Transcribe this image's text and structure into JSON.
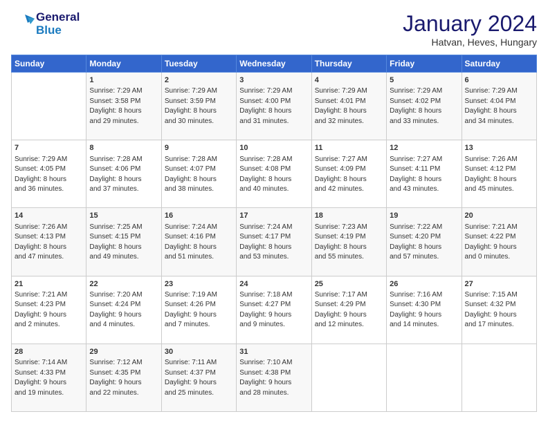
{
  "header": {
    "logo_line1": "General",
    "logo_line2": "Blue",
    "month_title": "January 2024",
    "subtitle": "Hatvan, Heves, Hungary"
  },
  "days": [
    "Sunday",
    "Monday",
    "Tuesday",
    "Wednesday",
    "Thursday",
    "Friday",
    "Saturday"
  ],
  "weeks": [
    [
      {
        "date": "",
        "content": ""
      },
      {
        "date": "1",
        "content": "Sunrise: 7:29 AM\nSunset: 3:58 PM\nDaylight: 8 hours\nand 29 minutes."
      },
      {
        "date": "2",
        "content": "Sunrise: 7:29 AM\nSunset: 3:59 PM\nDaylight: 8 hours\nand 30 minutes."
      },
      {
        "date": "3",
        "content": "Sunrise: 7:29 AM\nSunset: 4:00 PM\nDaylight: 8 hours\nand 31 minutes."
      },
      {
        "date": "4",
        "content": "Sunrise: 7:29 AM\nSunset: 4:01 PM\nDaylight: 8 hours\nand 32 minutes."
      },
      {
        "date": "5",
        "content": "Sunrise: 7:29 AM\nSunset: 4:02 PM\nDaylight: 8 hours\nand 33 minutes."
      },
      {
        "date": "6",
        "content": "Sunrise: 7:29 AM\nSunset: 4:04 PM\nDaylight: 8 hours\nand 34 minutes."
      }
    ],
    [
      {
        "date": "7",
        "content": "Sunrise: 7:29 AM\nSunset: 4:05 PM\nDaylight: 8 hours\nand 36 minutes."
      },
      {
        "date": "8",
        "content": "Sunrise: 7:28 AM\nSunset: 4:06 PM\nDaylight: 8 hours\nand 37 minutes."
      },
      {
        "date": "9",
        "content": "Sunrise: 7:28 AM\nSunset: 4:07 PM\nDaylight: 8 hours\nand 38 minutes."
      },
      {
        "date": "10",
        "content": "Sunrise: 7:28 AM\nSunset: 4:08 PM\nDaylight: 8 hours\nand 40 minutes."
      },
      {
        "date": "11",
        "content": "Sunrise: 7:27 AM\nSunset: 4:09 PM\nDaylight: 8 hours\nand 42 minutes."
      },
      {
        "date": "12",
        "content": "Sunrise: 7:27 AM\nSunset: 4:11 PM\nDaylight: 8 hours\nand 43 minutes."
      },
      {
        "date": "13",
        "content": "Sunrise: 7:26 AM\nSunset: 4:12 PM\nDaylight: 8 hours\nand 45 minutes."
      }
    ],
    [
      {
        "date": "14",
        "content": "Sunrise: 7:26 AM\nSunset: 4:13 PM\nDaylight: 8 hours\nand 47 minutes."
      },
      {
        "date": "15",
        "content": "Sunrise: 7:25 AM\nSunset: 4:15 PM\nDaylight: 8 hours\nand 49 minutes."
      },
      {
        "date": "16",
        "content": "Sunrise: 7:24 AM\nSunset: 4:16 PM\nDaylight: 8 hours\nand 51 minutes."
      },
      {
        "date": "17",
        "content": "Sunrise: 7:24 AM\nSunset: 4:17 PM\nDaylight: 8 hours\nand 53 minutes."
      },
      {
        "date": "18",
        "content": "Sunrise: 7:23 AM\nSunset: 4:19 PM\nDaylight: 8 hours\nand 55 minutes."
      },
      {
        "date": "19",
        "content": "Sunrise: 7:22 AM\nSunset: 4:20 PM\nDaylight: 8 hours\nand 57 minutes."
      },
      {
        "date": "20",
        "content": "Sunrise: 7:21 AM\nSunset: 4:22 PM\nDaylight: 9 hours\nand 0 minutes."
      }
    ],
    [
      {
        "date": "21",
        "content": "Sunrise: 7:21 AM\nSunset: 4:23 PM\nDaylight: 9 hours\nand 2 minutes."
      },
      {
        "date": "22",
        "content": "Sunrise: 7:20 AM\nSunset: 4:24 PM\nDaylight: 9 hours\nand 4 minutes."
      },
      {
        "date": "23",
        "content": "Sunrise: 7:19 AM\nSunset: 4:26 PM\nDaylight: 9 hours\nand 7 minutes."
      },
      {
        "date": "24",
        "content": "Sunrise: 7:18 AM\nSunset: 4:27 PM\nDaylight: 9 hours\nand 9 minutes."
      },
      {
        "date": "25",
        "content": "Sunrise: 7:17 AM\nSunset: 4:29 PM\nDaylight: 9 hours\nand 12 minutes."
      },
      {
        "date": "26",
        "content": "Sunrise: 7:16 AM\nSunset: 4:30 PM\nDaylight: 9 hours\nand 14 minutes."
      },
      {
        "date": "27",
        "content": "Sunrise: 7:15 AM\nSunset: 4:32 PM\nDaylight: 9 hours\nand 17 minutes."
      }
    ],
    [
      {
        "date": "28",
        "content": "Sunrise: 7:14 AM\nSunset: 4:33 PM\nDaylight: 9 hours\nand 19 minutes."
      },
      {
        "date": "29",
        "content": "Sunrise: 7:12 AM\nSunset: 4:35 PM\nDaylight: 9 hours\nand 22 minutes."
      },
      {
        "date": "30",
        "content": "Sunrise: 7:11 AM\nSunset: 4:37 PM\nDaylight: 9 hours\nand 25 minutes."
      },
      {
        "date": "31",
        "content": "Sunrise: 7:10 AM\nSunset: 4:38 PM\nDaylight: 9 hours\nand 28 minutes."
      },
      {
        "date": "",
        "content": ""
      },
      {
        "date": "",
        "content": ""
      },
      {
        "date": "",
        "content": ""
      }
    ]
  ]
}
